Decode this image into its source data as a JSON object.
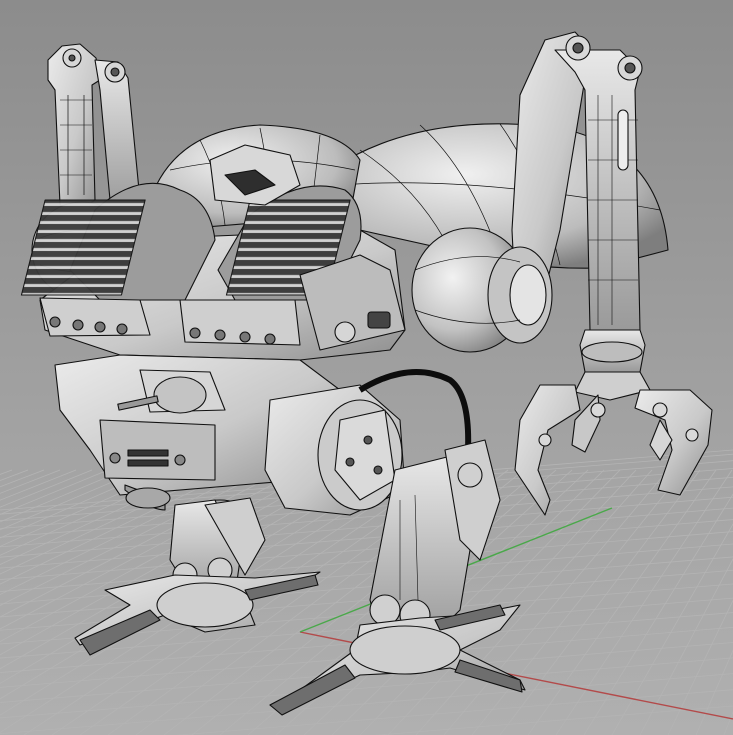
{
  "viewport": {
    "view": "perspective",
    "display_mode": "shaded-with-edges"
  },
  "grid": {
    "visible": true,
    "x_axis_color": "#b34a4a",
    "y_axis_color": "#4aa84a"
  },
  "model": {
    "subject": "walker-mech",
    "material_color": "#cfcfcf",
    "edge_color": "#111111",
    "cable_color": "#0d0d0d"
  },
  "colors": {
    "background_top": "#8e8e8e",
    "background_bottom": "#a6a6a6",
    "grid_line": "#b4b4b4"
  }
}
